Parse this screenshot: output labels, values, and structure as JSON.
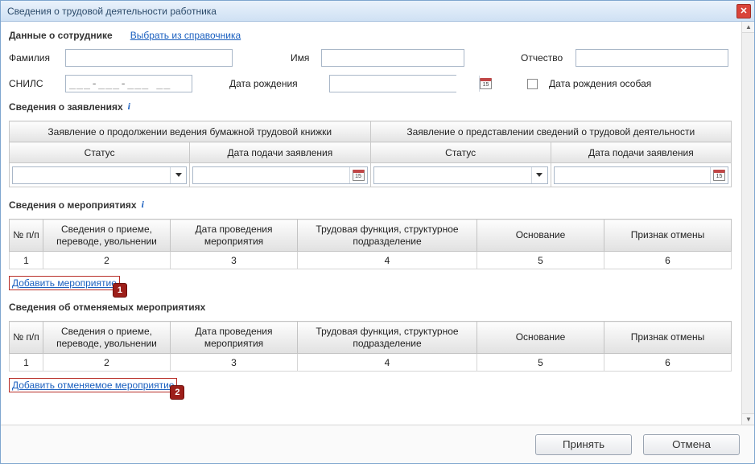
{
  "window": {
    "title": "Сведения о трудовой деятельности работника",
    "close_label": "✕"
  },
  "employee": {
    "section_title": "Данные о сотруднике",
    "select_from_dir": "Выбрать из справочника",
    "lastname_label": "Фамилия",
    "firstname_label": "Имя",
    "middlename_label": "Отчество",
    "lastname": "",
    "firstname": "",
    "middlename": "",
    "snils_label": "СНИЛС",
    "snils_placeholder": "___-___-___ __",
    "dob_label": "Дата рождения",
    "dob_value": "",
    "dob_special_label": "Дата рождения особая",
    "calendar_day": "15"
  },
  "applications": {
    "section_title": "Сведения о заявлениях",
    "group_paper": "Заявление о продолжении ведения бумажной трудовой книжки",
    "group_info": "Заявление о представлении сведений о трудовой деятельности",
    "col_status": "Статус",
    "col_date": "Дата подачи заявления",
    "status1": "",
    "date1": "",
    "status2": "",
    "date2": "",
    "calendar_day": "15"
  },
  "events": {
    "section_title": "Сведения о мероприятиях",
    "col_no": "№ п/п",
    "col_details": "Сведения о приеме, переводе, увольнении",
    "col_date": "Дата проведения мероприятия",
    "col_function": "Трудовая функция, структурное подразделение",
    "col_basis": "Основание",
    "col_cancel": "Признак отмены",
    "rows": [
      {
        "c1": "1",
        "c2": "2",
        "c3": "3",
        "c4": "4",
        "c5": "5",
        "c6": "6"
      }
    ],
    "add_label": "Добавить мероприятие",
    "badge": "1"
  },
  "cancelled": {
    "section_title": "Сведения об отменяемых мероприятиях",
    "col_no": "№ п/п",
    "col_details": "Сведения о приеме, переводе, увольнении",
    "col_date": "Дата проведения мероприятия",
    "col_function": "Трудовая функция, структурное подразделение",
    "col_basis": "Основание",
    "col_cancel": "Признак отмены",
    "rows": [
      {
        "c1": "1",
        "c2": "2",
        "c3": "3",
        "c4": "4",
        "c5": "5",
        "c6": "6"
      }
    ],
    "add_label": "Добавить отменяемое мероприятие",
    "badge": "2"
  },
  "footer": {
    "accept": "Принять",
    "cancel": "Отмена"
  }
}
